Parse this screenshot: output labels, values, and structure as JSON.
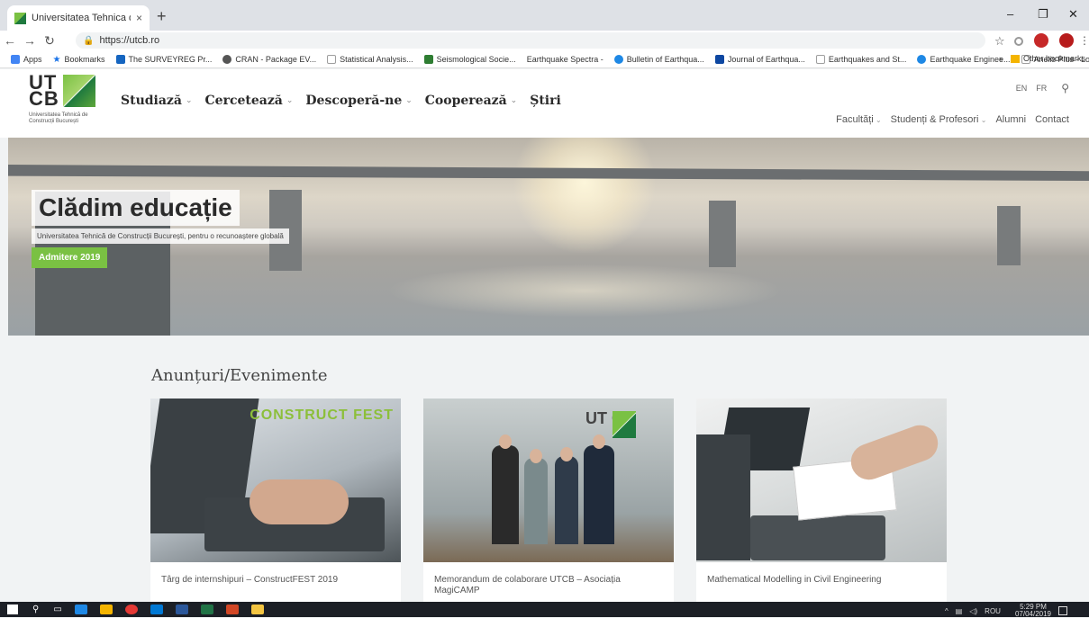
{
  "browser": {
    "tab_title": "Universitatea Tehnica de Constru",
    "tab_close": "×",
    "new_tab": "+",
    "url": "https://utcb.ro",
    "bookmarks": [
      {
        "label": "Apps",
        "color": "#4285f4"
      },
      {
        "label": "Bookmarks",
        "color": "#1a73e8"
      },
      {
        "label": "The SURVEYREG Pr...",
        "color": "#1565c0"
      },
      {
        "label": "CRAN - Package EV...",
        "color": "#555555"
      },
      {
        "label": "Statistical Analysis...",
        "color": "#9e9e9e"
      },
      {
        "label": "Seismological Socie...",
        "color": "#2e7d32"
      },
      {
        "label": "Earthquake Spectra -",
        "color": "#ffffff"
      },
      {
        "label": "Bulletin of Earthqua...",
        "color": "#1e88e5"
      },
      {
        "label": "Journal of Earthqua...",
        "color": "#0d47a1"
      },
      {
        "label": "Earthquakes and St...",
        "color": "#9e9e9e"
      },
      {
        "label": "Earthquake Enginee...",
        "color": "#1e88e5"
      },
      {
        "label": "Anelis Plus - Log In",
        "color": "#9e9e9e"
      }
    ],
    "overflow": "»",
    "other_bookmarks": "Other bookmarks"
  },
  "site": {
    "logo_line1": "UT",
    "logo_line2": "CB",
    "logo_sub": "Universitatea Tehnică de Construcții București",
    "nav": [
      "Studiază",
      "Cercetează",
      "Descoperă-ne",
      "Cooperează",
      "Știri"
    ],
    "langs": [
      "EN",
      "FR"
    ],
    "subnav": [
      "Facultăți",
      "Studenți & Profesori",
      "Alumni",
      "Contact"
    ]
  },
  "hero": {
    "title": "Clădim educație",
    "subtitle": "Universitatea Tehnică de Construcții București, pentru o recunoaștere globală",
    "button": "Admitere 2019"
  },
  "announcements": {
    "title": "Anunțuri/Evenimente",
    "cards": [
      {
        "title": "Târg de internshipuri – ConstructFEST 2019",
        "badge": "CONSTRUCT FEST"
      },
      {
        "title": "Memorandum de colaborare UTCB – Asociația MagiCAMP",
        "badge": "UT CB"
      },
      {
        "title": "Mathematical Modelling in Civil Engineering"
      }
    ]
  },
  "taskbar": {
    "lang": "ROU",
    "time": "5:29 PM",
    "date": "07/04/2019"
  },
  "colors": {
    "brand_green": "#7ac143",
    "dark_green": "#1f7a3f"
  }
}
